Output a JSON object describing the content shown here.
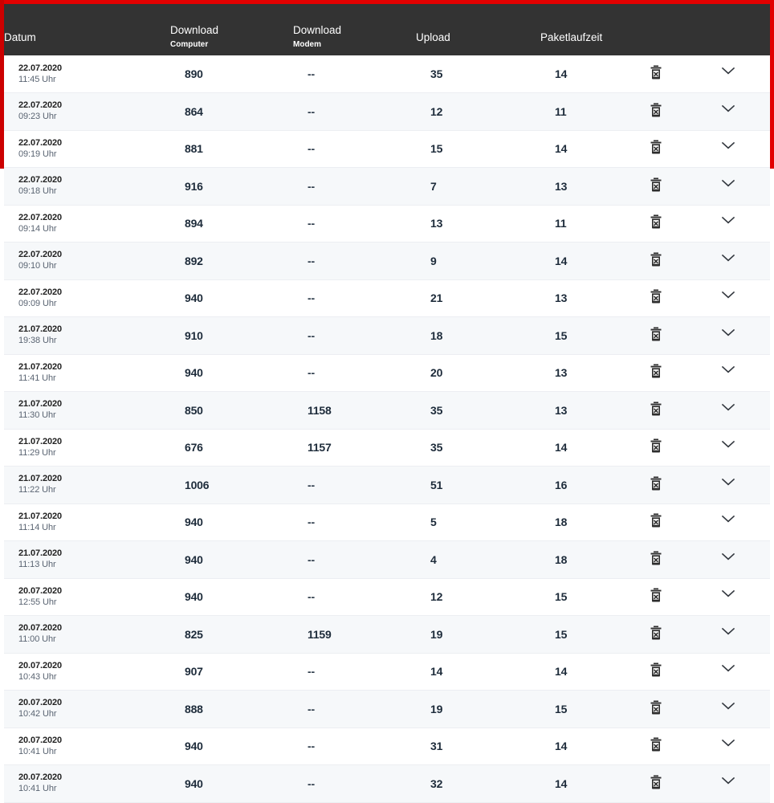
{
  "table": {
    "columns": [
      {
        "key": "datum",
        "label": "Datum",
        "sub": ""
      },
      {
        "key": "dlcomp",
        "label": "Download",
        "sub": "Computer"
      },
      {
        "key": "dlmodem",
        "label": "Download",
        "sub": "Modem"
      },
      {
        "key": "upload",
        "label": "Upload",
        "sub": ""
      },
      {
        "key": "paket",
        "label": "Paketlaufzeit",
        "sub": ""
      },
      {
        "key": "delete",
        "label": "",
        "sub": ""
      },
      {
        "key": "expand",
        "label": "",
        "sub": ""
      }
    ],
    "actions": {
      "delete_icon": "trash-icon",
      "expand_icon": "chevron-down-icon"
    },
    "rows": [
      {
        "date": "22.07.2020",
        "time": "11:45 Uhr",
        "download_computer": "890",
        "download_modem": "--",
        "upload": "35",
        "paketlaufzeit": "14"
      },
      {
        "date": "22.07.2020",
        "time": "09:23 Uhr",
        "download_computer": "864",
        "download_modem": "--",
        "upload": "12",
        "paketlaufzeit": "11"
      },
      {
        "date": "22.07.2020",
        "time": "09:19 Uhr",
        "download_computer": "881",
        "download_modem": "--",
        "upload": "15",
        "paketlaufzeit": "14"
      },
      {
        "date": "22.07.2020",
        "time": "09:18 Uhr",
        "download_computer": "916",
        "download_modem": "--",
        "upload": "7",
        "paketlaufzeit": "13"
      },
      {
        "date": "22.07.2020",
        "time": "09:14 Uhr",
        "download_computer": "894",
        "download_modem": "--",
        "upload": "13",
        "paketlaufzeit": "11"
      },
      {
        "date": "22.07.2020",
        "time": "09:10 Uhr",
        "download_computer": "892",
        "download_modem": "--",
        "upload": "9",
        "paketlaufzeit": "14"
      },
      {
        "date": "22.07.2020",
        "time": "09:09 Uhr",
        "download_computer": "940",
        "download_modem": "--",
        "upload": "21",
        "paketlaufzeit": "13"
      },
      {
        "date": "21.07.2020",
        "time": "19:38 Uhr",
        "download_computer": "910",
        "download_modem": "--",
        "upload": "18",
        "paketlaufzeit": "15"
      },
      {
        "date": "21.07.2020",
        "time": "11:41 Uhr",
        "download_computer": "940",
        "download_modem": "--",
        "upload": "20",
        "paketlaufzeit": "13"
      },
      {
        "date": "21.07.2020",
        "time": "11:30 Uhr",
        "download_computer": "850",
        "download_modem": "1158",
        "upload": "35",
        "paketlaufzeit": "13"
      },
      {
        "date": "21.07.2020",
        "time": "11:29 Uhr",
        "download_computer": "676",
        "download_modem": "1157",
        "upload": "35",
        "paketlaufzeit": "14"
      },
      {
        "date": "21.07.2020",
        "time": "11:22 Uhr",
        "download_computer": "1006",
        "download_modem": "--",
        "upload": "51",
        "paketlaufzeit": "16"
      },
      {
        "date": "21.07.2020",
        "time": "11:14 Uhr",
        "download_computer": "940",
        "download_modem": "--",
        "upload": "5",
        "paketlaufzeit": "18"
      },
      {
        "date": "21.07.2020",
        "time": "11:13 Uhr",
        "download_computer": "940",
        "download_modem": "--",
        "upload": "4",
        "paketlaufzeit": "18"
      },
      {
        "date": "20.07.2020",
        "time": "12:55 Uhr",
        "download_computer": "940",
        "download_modem": "--",
        "upload": "12",
        "paketlaufzeit": "15"
      },
      {
        "date": "20.07.2020",
        "time": "11:00 Uhr",
        "download_computer": "825",
        "download_modem": "1159",
        "upload": "19",
        "paketlaufzeit": "15"
      },
      {
        "date": "20.07.2020",
        "time": "10:43 Uhr",
        "download_computer": "907",
        "download_modem": "--",
        "upload": "14",
        "paketlaufzeit": "14"
      },
      {
        "date": "20.07.2020",
        "time": "10:42 Uhr",
        "download_computer": "888",
        "download_modem": "--",
        "upload": "19",
        "paketlaufzeit": "15"
      },
      {
        "date": "20.07.2020",
        "time": "10:41 Uhr",
        "download_computer": "940",
        "download_modem": "--",
        "upload": "31",
        "paketlaufzeit": "14"
      },
      {
        "date": "20.07.2020",
        "time": "10:41 Uhr",
        "download_computer": "940",
        "download_modem": "--",
        "upload": "32",
        "paketlaufzeit": "14"
      }
    ]
  },
  "colors": {
    "accent_red": "#e20000",
    "header_bg": "#333333",
    "row_alt_bg": "#f6f8fa",
    "text_primary": "#1d2b3a",
    "text_secondary": "#5a6472"
  }
}
